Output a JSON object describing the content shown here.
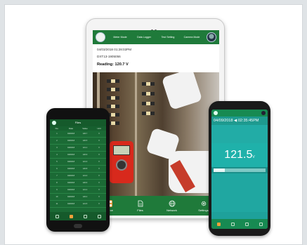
{
  "tablet": {
    "tabs": [
      "Meter Mode",
      "Data Logger",
      "Test Setting",
      "Camera Mode"
    ],
    "datetime": "04/03/2018 01:28:02PM",
    "device_id": "DXT13-1905056",
    "reading": "Reading: 120.7 V",
    "nav": [
      {
        "label": "Source",
        "icon": "grid-icon",
        "active": true
      },
      {
        "label": "Files",
        "icon": "file-icon",
        "active": false
      },
      {
        "label": "Network",
        "icon": "globe-icon",
        "active": false
      },
      {
        "label": "Settings",
        "icon": "gear-icon",
        "active": false
      }
    ]
  },
  "phone_left": {
    "title": "Files",
    "columns": [
      "No.",
      "Date",
      "Value",
      "Unit"
    ],
    "rows": [
      [
        "1",
        "04/03/18",
        "120.7",
        "V"
      ],
      [
        "2",
        "04/03/18",
        "120.5",
        "V"
      ],
      [
        "3",
        "04/03/18",
        "121.1",
        "V"
      ],
      [
        "4",
        "04/03/18",
        "120.9",
        "V"
      ],
      [
        "5",
        "04/03/18",
        "121.3",
        "V"
      ],
      [
        "6",
        "04/03/18",
        "120.8",
        "V"
      ],
      [
        "7",
        "04/03/18",
        "121.0",
        "V"
      ],
      [
        "8",
        "04/03/18",
        "120.6",
        "V"
      ],
      [
        "9",
        "04/03/18",
        "121.2",
        "V"
      ],
      [
        "10",
        "04/03/18",
        "120.4",
        "V"
      ],
      [
        "11",
        "04/03/18",
        "121.5",
        "V"
      ]
    ]
  },
  "phone_right": {
    "datetime": "04/09/2018 ◀ 02:35:45PM",
    "reading": "121.5",
    "unit": "V",
    "level": 0.22
  },
  "colors": {
    "primary_green": "#1f7a3a",
    "teal": "#1fb1aa",
    "accent_orange": "#f2a03a",
    "meter_red": "#d8291c"
  }
}
